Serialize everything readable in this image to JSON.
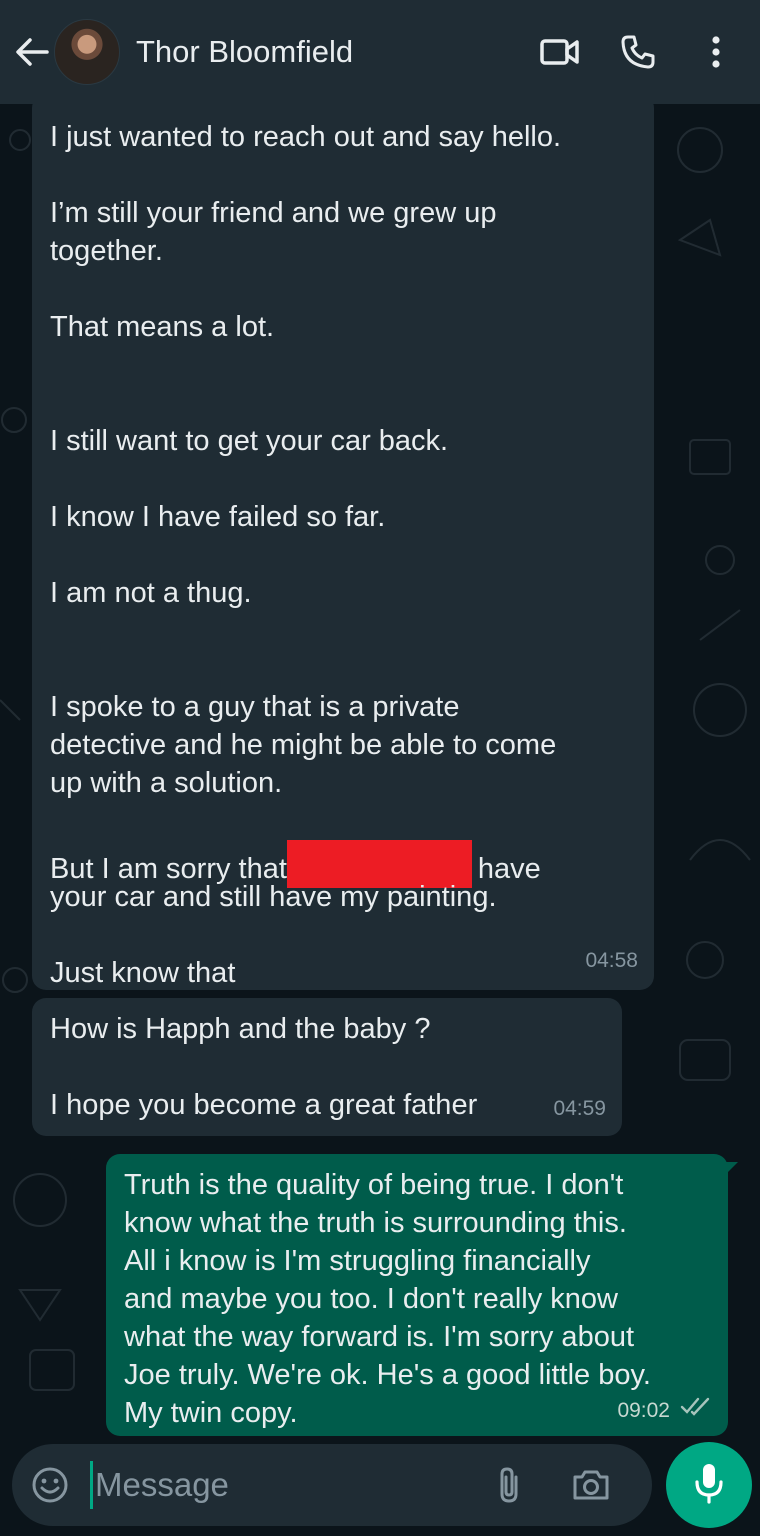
{
  "header": {
    "contact_name": "Thor Bloomfield",
    "icons": [
      "back-arrow-icon",
      "video-call-icon",
      "voice-call-icon",
      "more-options-icon"
    ]
  },
  "messages": [
    {
      "direction": "incoming",
      "lines": [
        "I just wanted to reach out and say hello.",
        "",
        "I’m still your friend and we grew up",
        "together.",
        "",
        "That means a lot.",
        "",
        "",
        "I still want to get your car back.",
        "",
        "I know I have failed so far.",
        "",
        "I am not a thug.",
        "",
        "",
        "I spoke to a guy that is a private",
        "detective and he might be able to come",
        "up with a solution.",
        "",
        "But I am sorry that",
        "your car and still have my painting.",
        "",
        "Just know that"
      ],
      "redacted_line_suffix": "have",
      "time": "04:58"
    },
    {
      "direction": "incoming",
      "lines": [
        "How is Happh and the baby ?",
        "",
        "I hope you become a great father"
      ],
      "time": "04:59"
    },
    {
      "direction": "outgoing",
      "lines": [
        "Truth is the quality of being true. I don't",
        "know what the truth is surrounding this.",
        "All i know is I'm struggling financially",
        "and maybe you too. I don't really know",
        "what the way forward is. I'm sorry about",
        "Joe truly. We're ok. He's a good little boy.",
        "My twin copy."
      ],
      "time": "09:02",
      "status": "read"
    }
  ],
  "composer": {
    "placeholder": "Message",
    "value": "",
    "icons": [
      "emoji-icon",
      "attach-icon",
      "camera-icon",
      "mic-icon"
    ]
  },
  "colors": {
    "background": "#0b141a",
    "header": "#1f2c34",
    "incoming_bubble": "#1f2c34",
    "outgoing_bubble": "#005c4b",
    "accent": "#00a884",
    "redaction": "#ed1c24"
  }
}
